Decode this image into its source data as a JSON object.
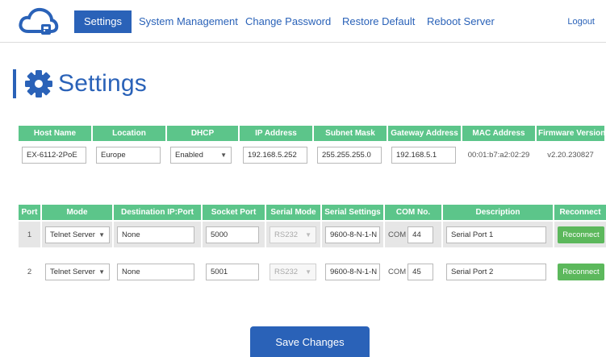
{
  "nav": {
    "items": [
      "Settings",
      "System Management",
      "Change Password",
      "Restore Default",
      "Reboot Server"
    ],
    "logout": "Logout"
  },
  "page": {
    "title": "Settings"
  },
  "network": {
    "headers": [
      "Host Name",
      "Location",
      "DHCP",
      "IP Address",
      "Subnet Mask",
      "Gateway Address",
      "MAC Address",
      "Firmware Version"
    ],
    "host_name": "EX-6112-2PoE",
    "location": "Europe",
    "dhcp": "Enabled",
    "ip_address": "192.168.5.252",
    "subnet_mask": "255.255.255.0",
    "gateway": "192.168.5.1",
    "mac_address": "00:01:b7:a2:02:29",
    "firmware": "v2.20.230827"
  },
  "ports": {
    "headers": [
      "Port",
      "Mode",
      "Destination IP:Port",
      "Socket Port",
      "Serial Mode",
      "Serial Settings",
      "COM No.",
      "Description",
      "Reconnect"
    ],
    "com_label": "COM",
    "rows": [
      {
        "port": "1",
        "mode": "Telnet Server",
        "destination": "None",
        "socket_port": "5000",
        "serial_mode": "RS232",
        "serial_settings": "9600-8-N-1-N",
        "com_no": "44",
        "description": "Serial Port 1",
        "reconnect": "Reconnect"
      },
      {
        "port": "2",
        "mode": "Telnet Server",
        "destination": "None",
        "socket_port": "5001",
        "serial_mode": "RS232",
        "serial_settings": "9600-8-N-1-N",
        "com_no": "45",
        "description": "Serial Port 2",
        "reconnect": "Reconnect"
      }
    ]
  },
  "actions": {
    "save": "Save Changes"
  },
  "colors": {
    "primary": "#2a62b8",
    "header_green": "#5cc58a",
    "button_green": "#5cb85c"
  },
  "icons": {
    "logo": "cloud-icon",
    "title": "gear-icon",
    "dropdown": "chevron-down-icon"
  }
}
